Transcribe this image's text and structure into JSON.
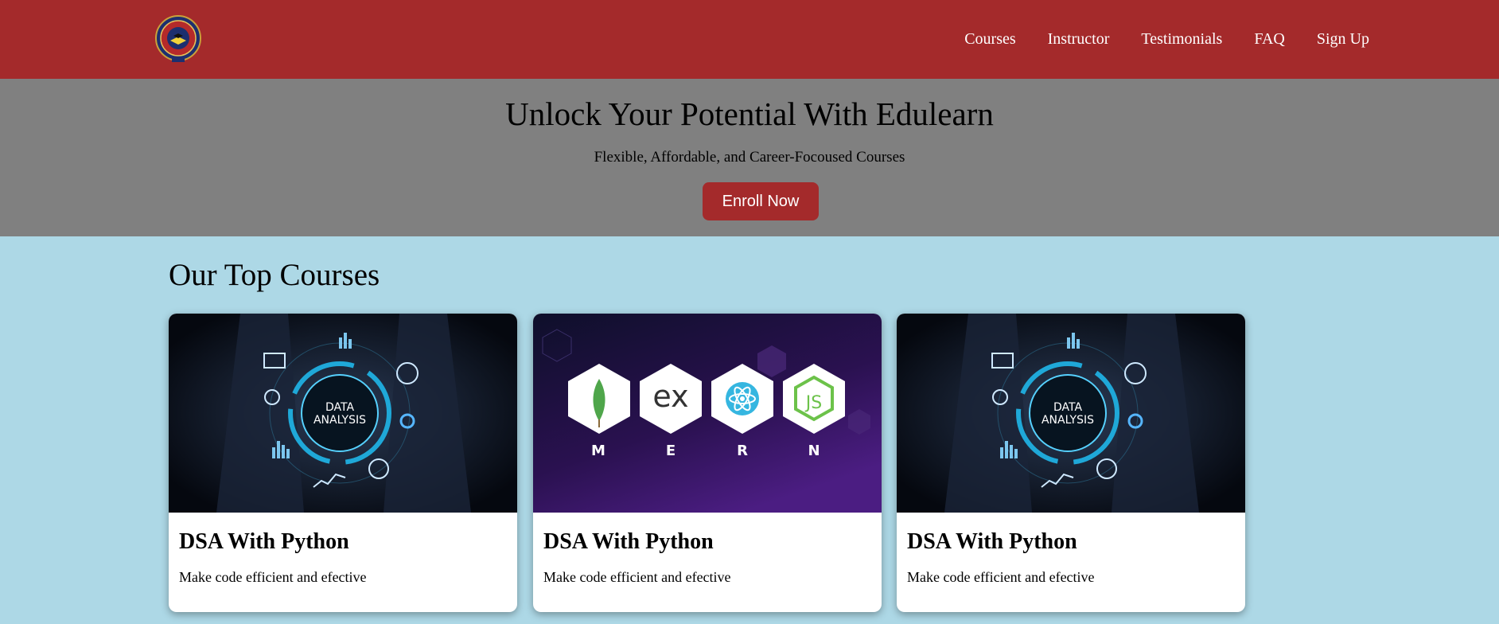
{
  "header": {
    "logo_icon": "edulearn-logo",
    "nav": [
      "Courses",
      "Instructor",
      "Testimonials",
      "FAQ",
      "Sign Up"
    ]
  },
  "hero": {
    "title": "Unlock Your Potential With Edulearn",
    "subtitle": "Flexible, Affordable, and Career-Focoused Courses",
    "cta_label": "Enroll Now"
  },
  "courses": {
    "heading": "Our Top Courses",
    "cards": [
      {
        "image": "data-analysis-image",
        "image_text": [
          "DATA",
          "ANALYSIS"
        ],
        "title": "DSA With Python",
        "description": "Make code efficient and efective"
      },
      {
        "image": "mern-stack-image",
        "image_text": [
          "ex",
          "M",
          "E",
          "R",
          "N"
        ],
        "title": "DSA With Python",
        "description": "Make code efficient and efective"
      },
      {
        "image": "data-analysis-image",
        "image_text": [
          "DATA",
          "ANALYSIS"
        ],
        "title": "DSA With Python",
        "description": "Make code efficient and efective"
      }
    ]
  },
  "colors": {
    "header_bg": "#a42a2b",
    "hero_bg": "#808080",
    "page_bg": "#add8e6",
    "button_bg": "#a42a2b"
  }
}
